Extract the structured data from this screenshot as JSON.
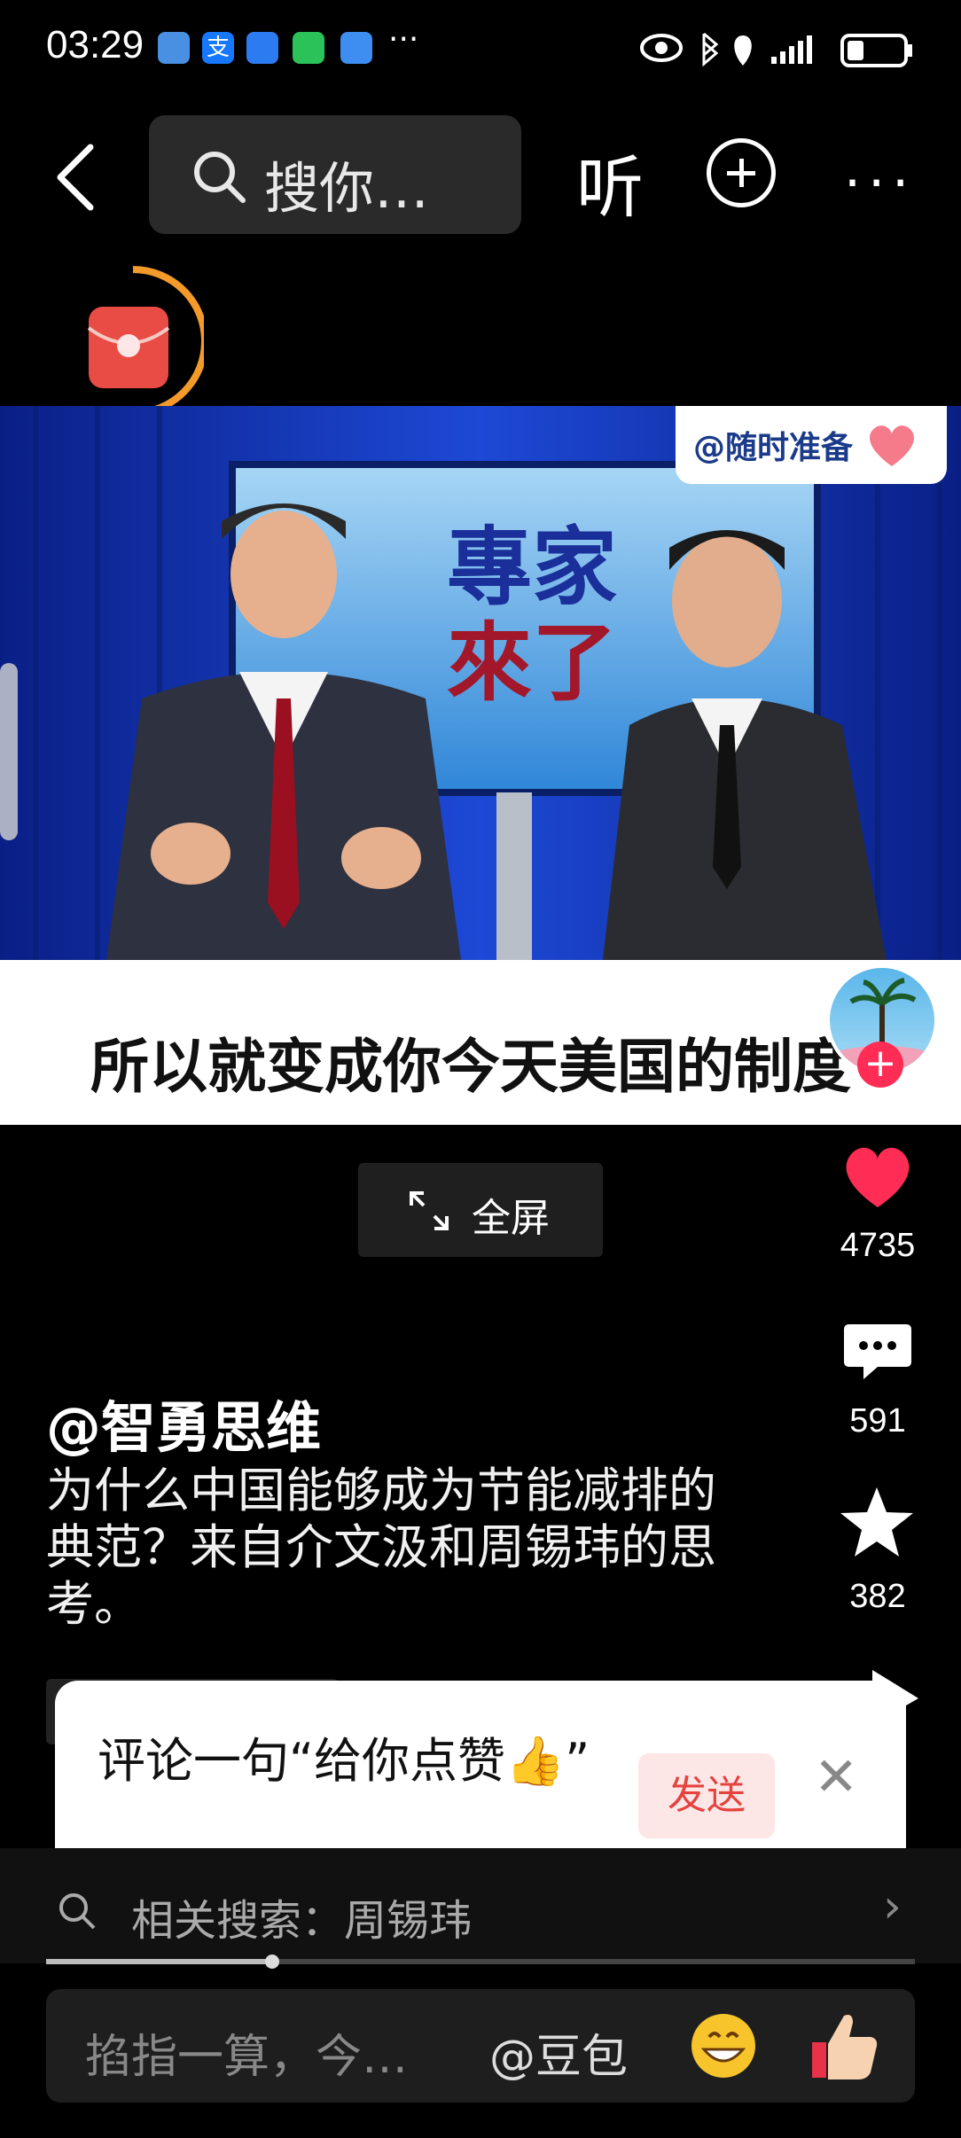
{
  "status_bar": {
    "time": "03:29",
    "app_icons": [
      "browser-icon",
      "alipay-icon",
      "bulb-icon",
      "wechat-icon",
      "compass-icon"
    ],
    "more": "···"
  },
  "nav": {
    "search_placeholder": "搜你…",
    "listen_label": "听"
  },
  "video": {
    "sticker_text": "@随时准备",
    "banner_line1": "專家",
    "banner_line2": "來了",
    "subtitle": "所以就变成你今天美国的制度"
  },
  "fullscreen_label": "全屏",
  "actions": {
    "like_count": "4735",
    "comment_count": "591",
    "favorite_count": "382"
  },
  "post": {
    "author": "@智勇思维",
    "description": "为什么中国能够成为节能减排的典范？来自介文汲和周锡玮的思考。"
  },
  "popup": {
    "text": "评论一句“给你点赞👍”",
    "send_label": "发送"
  },
  "related_search": "相关搜索：周锡玮",
  "progress": 0.26,
  "comment_bar": {
    "placeholder": "掐指一算，今…",
    "mention": "@豆包"
  },
  "colors": {
    "like": "#ff2c55",
    "send_text": "#e4433e",
    "send_bg": "#fde7e6"
  }
}
